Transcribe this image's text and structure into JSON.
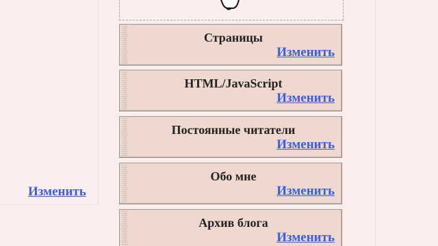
{
  "left_panel": {
    "edit_label": "Изменить"
  },
  "drop_zone": {
    "icon": "hand-pointer-icon"
  },
  "gadgets": [
    {
      "title": "Страницы",
      "edit_label": "Изменить"
    },
    {
      "title": "HTML/JavaScript",
      "edit_label": "Изменить"
    },
    {
      "title": "Постоянные читатели",
      "edit_label": "Изменить"
    },
    {
      "title": "Обо мне",
      "edit_label": "Изменить"
    },
    {
      "title": "Архив блога",
      "edit_label": "Изменить"
    }
  ],
  "colors": {
    "page_background": "#fbeeed",
    "gadget_background": "#eed8cf",
    "link": "#3d5fd6"
  }
}
